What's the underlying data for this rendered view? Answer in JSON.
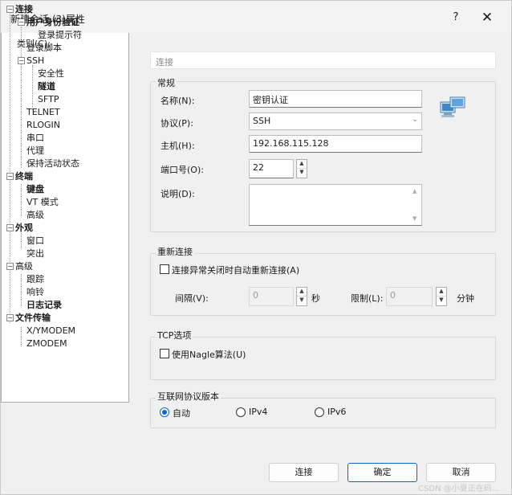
{
  "window": {
    "title": "新建会话 (3)属性",
    "help": "?",
    "close": "✕"
  },
  "category_label": "类别(C):",
  "tree": {
    "connection": "连接",
    "auth": "用户身份验证",
    "login_prompts": "登录提示符",
    "login_script": "登录脚本",
    "ssh": "SSH",
    "security": "安全性",
    "tunnel": "隧道",
    "sftp": "SFTP",
    "telnet": "TELNET",
    "rlogin": "RLOGIN",
    "serial": "串口",
    "proxy": "代理",
    "keepalive": "保持活动状态",
    "terminal": "终端",
    "keyboard": "键盘",
    "vt_mode": "VT 模式",
    "advanced_term": "高级",
    "appearance": "外观",
    "window": "窗口",
    "highlight": "突出",
    "advanced": "高级",
    "trace": "跟踪",
    "bell": "响铃",
    "logging": "日志记录",
    "file_transfer": "文件传输",
    "xymodem": "X/YMODEM",
    "zmodem": "ZMODEM"
  },
  "breadcrumb": "连接",
  "general": {
    "title": "常规",
    "name_label": "名称(N):",
    "name_value": "密钥认证",
    "protocol_label": "协议(P):",
    "protocol_value": "SSH",
    "host_label": "主机(H):",
    "host_value": "192.168.115.128",
    "port_label": "端口号(O):",
    "port_value": "22",
    "desc_label": "说明(D):",
    "desc_value": ""
  },
  "reconnect": {
    "title": "重新连接",
    "checkbox_label": "连接异常关闭时自动重新连接(A)",
    "interval_label": "间隔(V):",
    "interval_value": "0",
    "interval_unit": "秒",
    "limit_label": "限制(L):",
    "limit_value": "0",
    "limit_unit": "分钟"
  },
  "tcp": {
    "title": "TCP选项",
    "nagle_label": "使用Nagle算法(U)"
  },
  "ip_version": {
    "title": "互联网协议版本",
    "options": [
      "自动",
      "IPv4",
      "IPv6"
    ],
    "selected": "自动"
  },
  "buttons": {
    "connect": "连接",
    "ok": "确定",
    "cancel": "取消"
  },
  "watermark": "CSDN @小夏正在码..."
}
